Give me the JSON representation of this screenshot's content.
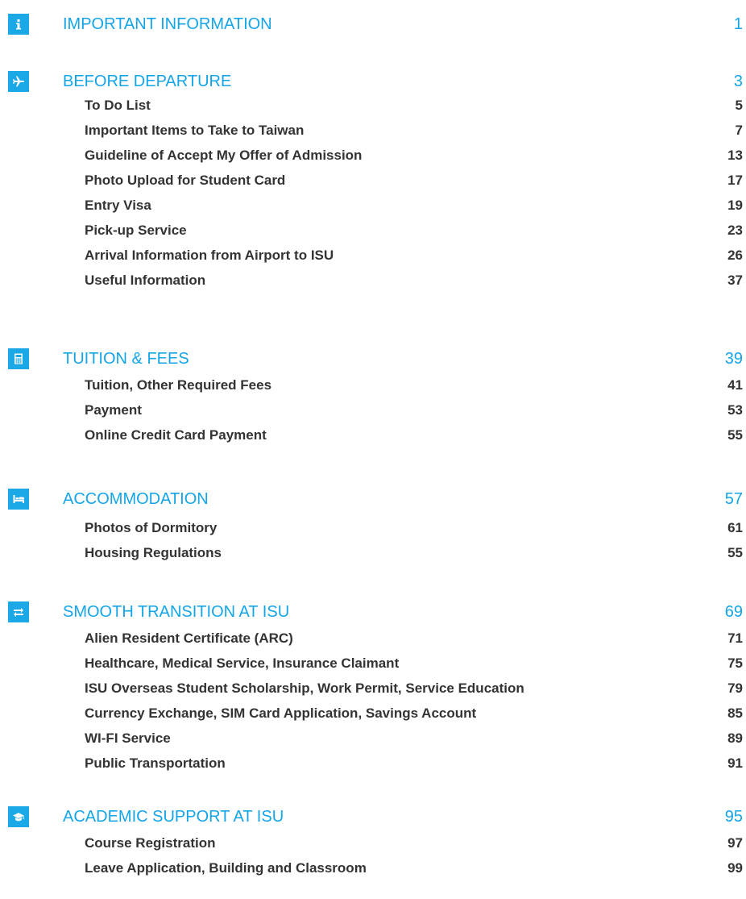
{
  "toc": {
    "sections": [
      {
        "icon": "info-icon",
        "title": "IMPORTANT INFORMATION",
        "page": "1",
        "items": []
      },
      {
        "icon": "airplane-icon",
        "title": "BEFORE DEPARTURE",
        "page": "3",
        "items": [
          {
            "label": "To Do List",
            "page": "5"
          },
          {
            "label": "Important Items to Take to Taiwan",
            "page": "7"
          },
          {
            "label": "Guideline of Accept My Offer of Admission",
            "page": "13"
          },
          {
            "label": "Photo Upload for Student Card",
            "page": "17"
          },
          {
            "label": "Entry Visa",
            "page": "19"
          },
          {
            "label": "Pick-up Service",
            "page": "23"
          },
          {
            "label": "Arrival Information from Airport to ISU",
            "page": "26"
          },
          {
            "label": "Useful Information",
            "page": "37"
          }
        ]
      },
      {
        "icon": "calculator-icon",
        "title": "TUITION & FEES",
        "page": "39",
        "items": [
          {
            "label": "Tuition, Other Required Fees",
            "page": "41"
          },
          {
            "label": "Payment",
            "page": "53"
          },
          {
            "label": "Online Credit Card Payment",
            "page": "55"
          }
        ]
      },
      {
        "icon": "bed-icon",
        "title": "ACCOMMODATION",
        "page": "57",
        "items": [
          {
            "label": "Photos of Dormitory",
            "page": "61"
          },
          {
            "label": "Housing Regulations",
            "page": "55"
          }
        ]
      },
      {
        "icon": "exchange-icon",
        "title": "SMOOTH TRANSITION AT ISU",
        "page": "69",
        "items": [
          {
            "label": "Alien Resident Certificate (ARC)",
            "page": "71"
          },
          {
            "label": "Healthcare, Medical Service, Insurance Claimant",
            "page": "75"
          },
          {
            "label": "ISU Overseas Student Scholarship, Work Permit, Service Education",
            "page": "79"
          },
          {
            "label": "Currency Exchange, SIM Card Application, Savings Account",
            "page": "85"
          },
          {
            "label": "WI-FI Service",
            "page": "89"
          },
          {
            "label": "Public Transportation",
            "page": "91"
          }
        ]
      },
      {
        "icon": "graduation-cap-icon",
        "title": "ACADEMIC SUPPORT AT ISU",
        "page": "95",
        "items": [
          {
            "label": "Course Registration",
            "page": "97"
          },
          {
            "label": "Leave Application, Building and Classroom",
            "page": "99"
          }
        ]
      }
    ]
  }
}
